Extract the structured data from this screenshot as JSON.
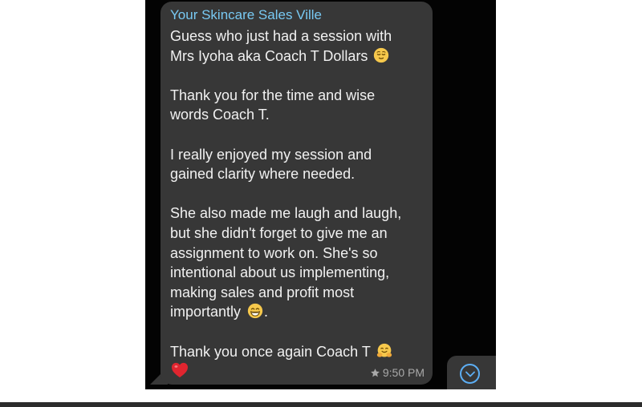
{
  "message": {
    "sender": "Your Skincare Sales Ville",
    "lines": {
      "l1": "Guess who just had a session with",
      "l2": "Mrs Iyoha aka Coach T Dollars",
      "l3": "Thank you for the time and wise",
      "l4": "words Coach T.",
      "l5": "I really enjoyed my session and",
      "l6": "gained clarity where needed.",
      "l7": "She also made me laugh and laugh,",
      "l8": "but she didn't forget to give me an",
      "l9": "assignment to work on. She's so",
      "l10": "intentional about us implementing,",
      "l11": "making sales and profit most",
      "l12": "importantly",
      "l12_end": ".",
      "l13": "Thank you once again Coach T"
    },
    "emojis": {
      "relieved": "relieved-face-emoji",
      "grinning": "grinning-face-emoji",
      "hugging": "hugging-face-emoji",
      "heart": "red-heart-emoji"
    },
    "time": "9:50 PM",
    "starred": true
  },
  "colors": {
    "background": "#030303",
    "bubble": "#373737",
    "sender": "#78c9f3",
    "text": "#f1f1f1",
    "meta": "#a9a9a9",
    "accent": "#5caef4"
  },
  "icons": {
    "star": "star-icon",
    "scroll_down": "chevron-down-circle-icon"
  }
}
